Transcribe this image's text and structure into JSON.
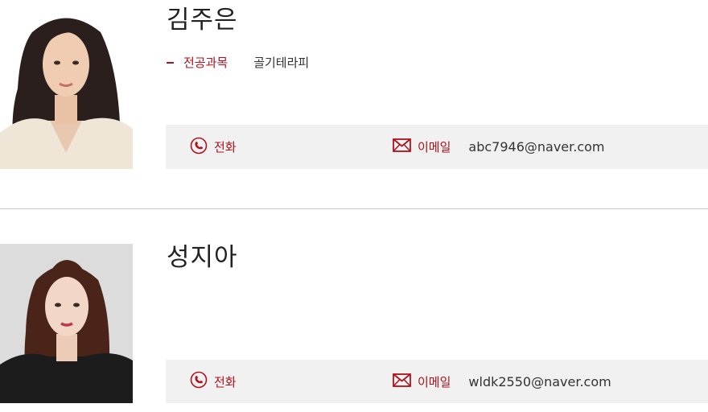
{
  "colors": {
    "accent": "#b0111b",
    "contact_bg": "#f1f1f1",
    "divider": "#c8c8c8"
  },
  "members": [
    {
      "name": "김주은",
      "subject_label": "전공과목",
      "subject_value": "골기테라피",
      "phone_label": "전화",
      "email_label": "이메일",
      "email": "abc7946@naver.com",
      "icons": [
        "person-photo",
        "phone-icon",
        "mail-icon"
      ]
    },
    {
      "name": "성지아",
      "phone_label": "전화",
      "email_label": "이메일",
      "email": "wldk2550@naver.com",
      "icons": [
        "person-photo",
        "phone-icon",
        "mail-icon"
      ]
    }
  ]
}
